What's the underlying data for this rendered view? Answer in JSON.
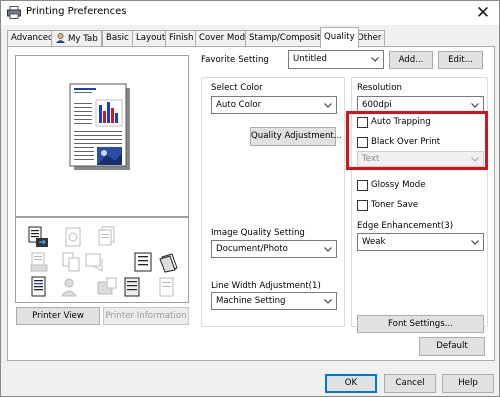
{
  "window": {
    "title": "Printing Preferences",
    "close_glyph": "✕",
    "icons": {
      "app": "printer-icon",
      "close": "close-icon"
    }
  },
  "tabs": [
    {
      "label": "Advanced"
    },
    {
      "label": "My Tab"
    },
    {
      "label": "Basic"
    },
    {
      "label": "Layout"
    },
    {
      "label": "Finish"
    },
    {
      "label": "Cover Mode"
    },
    {
      "label": "Stamp/Composition"
    },
    {
      "label": "Quality",
      "active": true
    },
    {
      "label": "Other"
    }
  ],
  "favorite": {
    "label": "Favorite Setting",
    "value": "Untitled",
    "add_label": "Add...",
    "edit_label": "Edit..."
  },
  "preview": {
    "printer_view_label": "Printer View",
    "printer_info_label": "Printer Information"
  },
  "select_color": {
    "label": "Select Color",
    "value": "Auto Color",
    "quality_adjustment_label": "Quality Adjustment..."
  },
  "image_quality": {
    "label": "Image Quality Setting",
    "value": "Document/Photo"
  },
  "line_width": {
    "label": "Line Width Adjustment(1)",
    "value": "Machine Setting"
  },
  "resolution": {
    "label": "Resolution",
    "value": "600dpi"
  },
  "options": {
    "auto_trapping": "Auto Trapping",
    "black_over_print": "Black Over Print",
    "black_over_print_value": "Text",
    "glossy_mode": "Glossy Mode",
    "toner_save": "Toner Save"
  },
  "edge": {
    "label": "Edge Enhancement(3)",
    "value": "Weak"
  },
  "font_settings_label": "Font Settings...",
  "default_label": "Default",
  "footer": {
    "ok": "OK",
    "cancel": "Cancel",
    "help": "Help"
  },
  "colors": {
    "highlight": "#d9121a",
    "default_button_border": "#0078d7",
    "chart_blue": "#1a3cc8",
    "chart_red": "#d01818",
    "photo_blue": "#2a4ea8"
  }
}
